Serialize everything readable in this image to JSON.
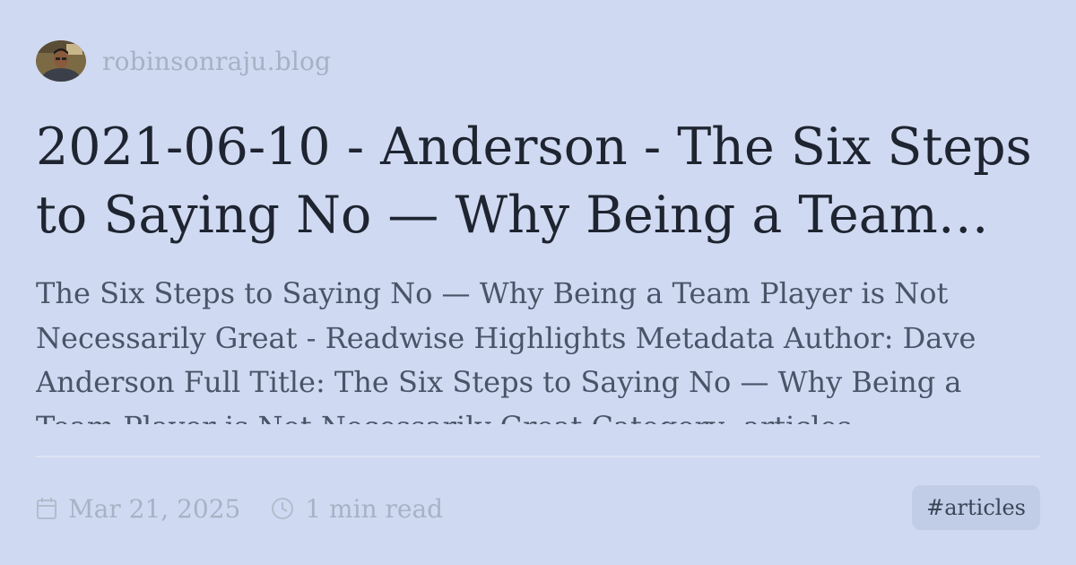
{
  "site": {
    "name": "robinsonraju.blog"
  },
  "post": {
    "title": "2021-06-10 - Anderson - The Six Steps to Saying No — Why Being a Team Player is Not Necessarily Great",
    "description": "The Six Steps to Saying No — Why Being a Team Player is Not Necessarily Great - Readwise Highlights Metadata Author: Dave Anderson Full Title: The Six Steps to Saying No — Why Being a Team Player is Not Necessarily Great Category: articles",
    "date": "Mar 21, 2025",
    "read_time": "1 min read",
    "tag": "#articles"
  },
  "icons": {
    "avatar": "author-photo",
    "date": "calendar-icon",
    "read_time": "clock-icon"
  },
  "colors": {
    "background": "#cfd9f1",
    "title": "#1e2430",
    "muted": "#a8b2c5",
    "tag_bg": "#c1cde6"
  }
}
